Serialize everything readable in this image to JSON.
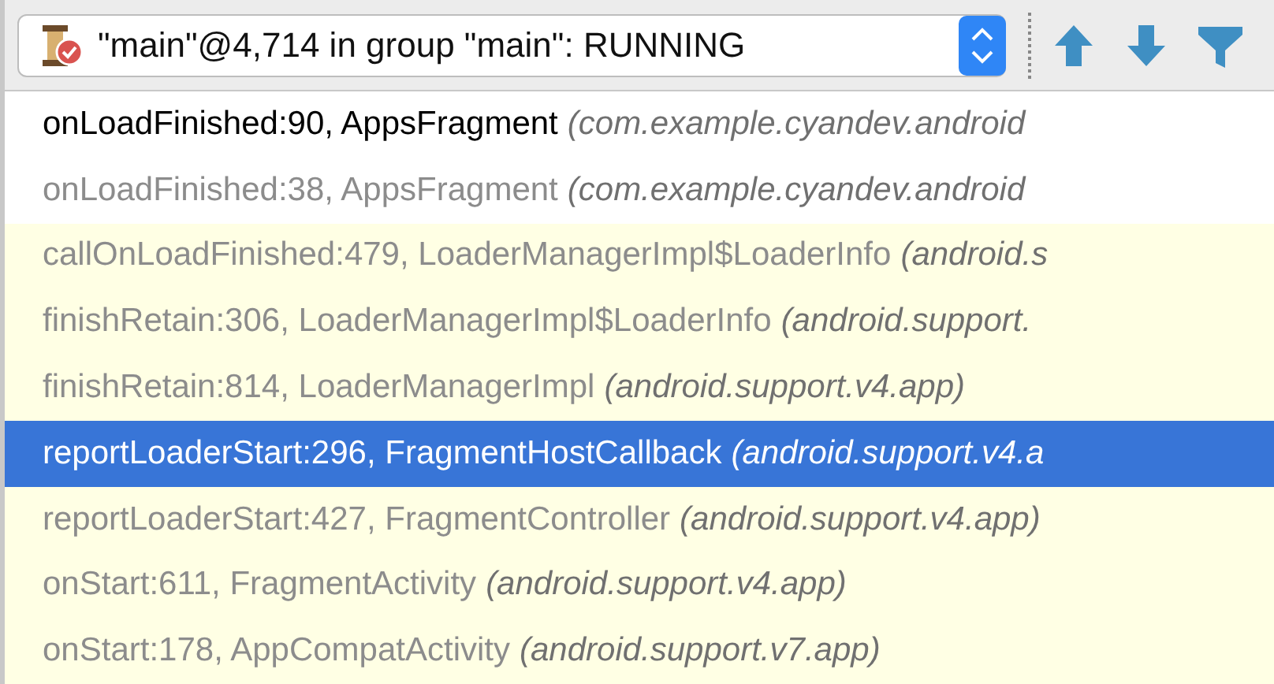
{
  "thread_selector": {
    "value": "\"main\"@4,714 in group \"main\": RUNNING"
  },
  "frames": [
    {
      "method": "onLoadFinished:90, AppsFragment",
      "package": "(com.example.cyandev.android",
      "library": false,
      "dimmed": false,
      "selected": false
    },
    {
      "method": "onLoadFinished:38, AppsFragment",
      "package": "(com.example.cyandev.android",
      "library": false,
      "dimmed": true,
      "selected": false
    },
    {
      "method": "callOnLoadFinished:479, LoaderManagerImpl$LoaderInfo",
      "package": "(android.s",
      "library": true,
      "dimmed": true,
      "selected": false
    },
    {
      "method": "finishRetain:306, LoaderManagerImpl$LoaderInfo",
      "package": "(android.support.",
      "library": true,
      "dimmed": true,
      "selected": false
    },
    {
      "method": "finishRetain:814, LoaderManagerImpl",
      "package": "(android.support.v4.app)",
      "library": true,
      "dimmed": true,
      "selected": false
    },
    {
      "method": "reportLoaderStart:296, FragmentHostCallback",
      "package": "(android.support.v4.a",
      "library": true,
      "dimmed": true,
      "selected": true
    },
    {
      "method": "reportLoaderStart:427, FragmentController",
      "package": "(android.support.v4.app)",
      "library": true,
      "dimmed": true,
      "selected": false
    },
    {
      "method": "onStart:611, FragmentActivity",
      "package": "(android.support.v4.app)",
      "library": true,
      "dimmed": true,
      "selected": false
    },
    {
      "method": "onStart:178, AppCompatActivity",
      "package": "(android.support.v7.app)",
      "library": true,
      "dimmed": true,
      "selected": false
    }
  ]
}
